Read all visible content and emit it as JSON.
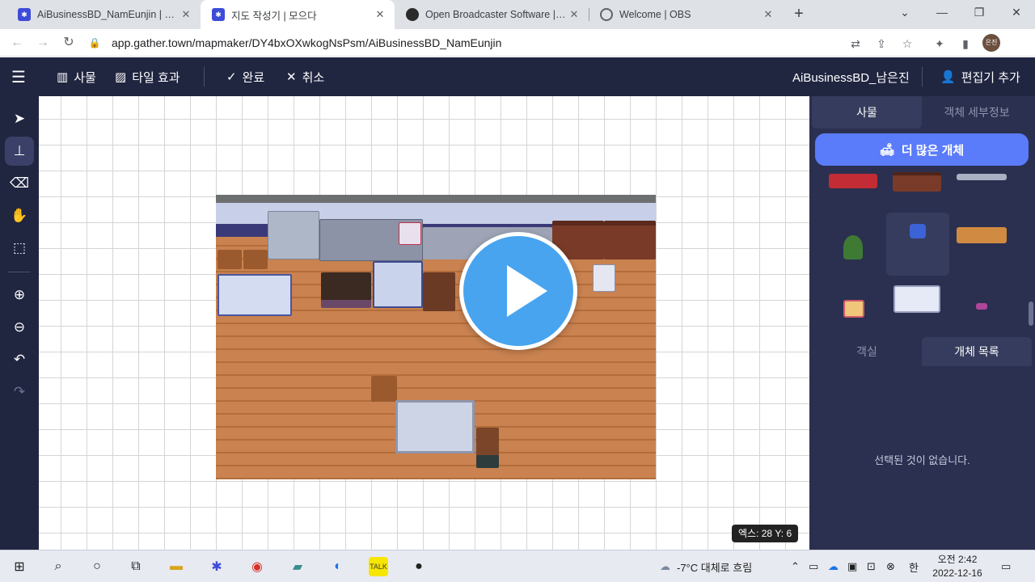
{
  "browser": {
    "tabs": [
      {
        "title": "AiBusinessBD_NamEunjin | Gath",
        "favicon": "gather-icon",
        "active": false
      },
      {
        "title": "지도 작성기 | 모으다",
        "favicon": "gather-icon",
        "active": true
      },
      {
        "title": "Open Broadcaster Software | Ol",
        "favicon": "obs-icon",
        "active": false
      },
      {
        "title": "Welcome | OBS",
        "favicon": "globe-icon",
        "active": false
      }
    ],
    "url": "app.gather.town/mapmaker/DY4bxOXwkogNsPsm/AiBusinessBD_NamEunjin",
    "profile_label": "은진"
  },
  "appbar": {
    "objects_label": "사물",
    "tile_effects_label": "타일 효과",
    "done_label": "완료",
    "cancel_label": "취소",
    "space_name": "AiBusinessBD_남은진",
    "add_editor_label": "편집기 추가"
  },
  "canvas": {
    "coords_label": "엑스: 28  Y: 6"
  },
  "right_panel": {
    "tab_objects": "사물",
    "tab_object_details": "객체 세부정보",
    "more_objects_button": "더 많은 개체",
    "tab_rooms": "객실",
    "tab_object_list": "개체 목록",
    "empty_message": "선택된 것이 없습니다."
  },
  "taskbar": {
    "weather": "-7°C  대체로 흐림",
    "ime": "한",
    "time": "오전 2:42",
    "date": "2022-12-16"
  },
  "colors": {
    "app_bg": "#202540",
    "panel_bg": "#2b3050",
    "accent": "#5a7bfa",
    "play_button": "#48a4ef"
  }
}
